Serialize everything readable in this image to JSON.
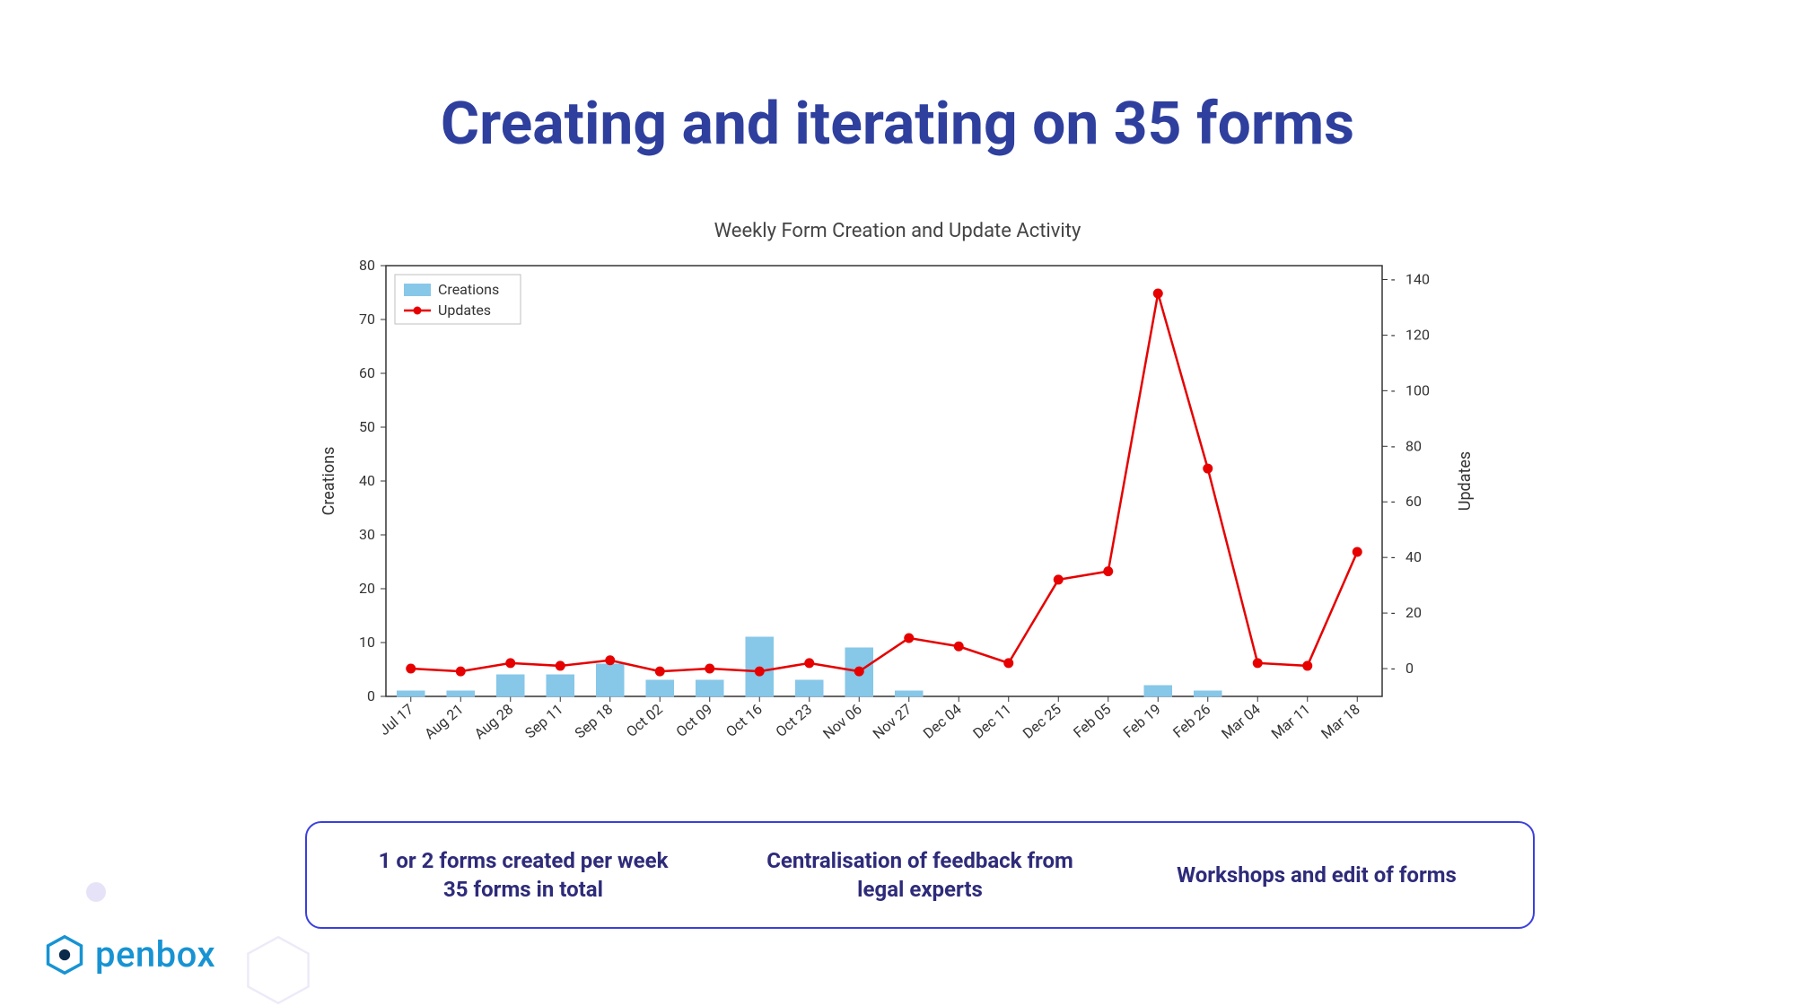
{
  "title": "Creating and iterating on 35 forms",
  "chart_data": {
    "type": "bar+line",
    "title": "Weekly Form Creation and Update Activity",
    "categories": [
      "Jul 17",
      "Aug 21",
      "Aug 28",
      "Sep 11",
      "Sep 18",
      "Oct 02",
      "Oct 09",
      "Oct 16",
      "Oct 23",
      "Nov 06",
      "Nov 27",
      "Dec 04",
      "Dec 11",
      "Dec 25",
      "Feb 05",
      "Feb 19",
      "Feb 26",
      "Mar 04",
      "Mar 11",
      "Mar 18"
    ],
    "series": [
      {
        "name": "Creations",
        "axis": "left",
        "kind": "bar",
        "values": [
          1,
          1,
          4,
          4,
          6,
          3,
          3,
          11,
          3,
          9,
          1,
          0,
          0,
          0,
          0,
          2,
          1,
          0,
          0,
          0
        ]
      },
      {
        "name": "Updates",
        "axis": "right",
        "kind": "line",
        "values": [
          0,
          -1,
          2,
          1,
          3,
          -1,
          0,
          -1,
          2,
          -1,
          11,
          8,
          2,
          32,
          35,
          135,
          72,
          2,
          1,
          42
        ]
      }
    ],
    "xlabel": "",
    "ylabel_left": "Creations",
    "ylabel_right": "Updates",
    "ylim_left": [
      0,
      80
    ],
    "yticks_left": [
      0,
      10,
      20,
      30,
      40,
      50,
      60,
      70,
      80
    ],
    "ylim_right": [
      -10,
      145
    ],
    "yticks_right": [
      0,
      20,
      40,
      60,
      80,
      100,
      120,
      140
    ],
    "legend": [
      "Creations",
      "Updates"
    ]
  },
  "captions": [
    "1 or 2 forms created per week\n35 forms in total",
    "Centralisation of feedback from\nlegal experts",
    "Workshops and edit of forms"
  ],
  "brand": {
    "name": "penbox",
    "accent": "#1793d3"
  }
}
